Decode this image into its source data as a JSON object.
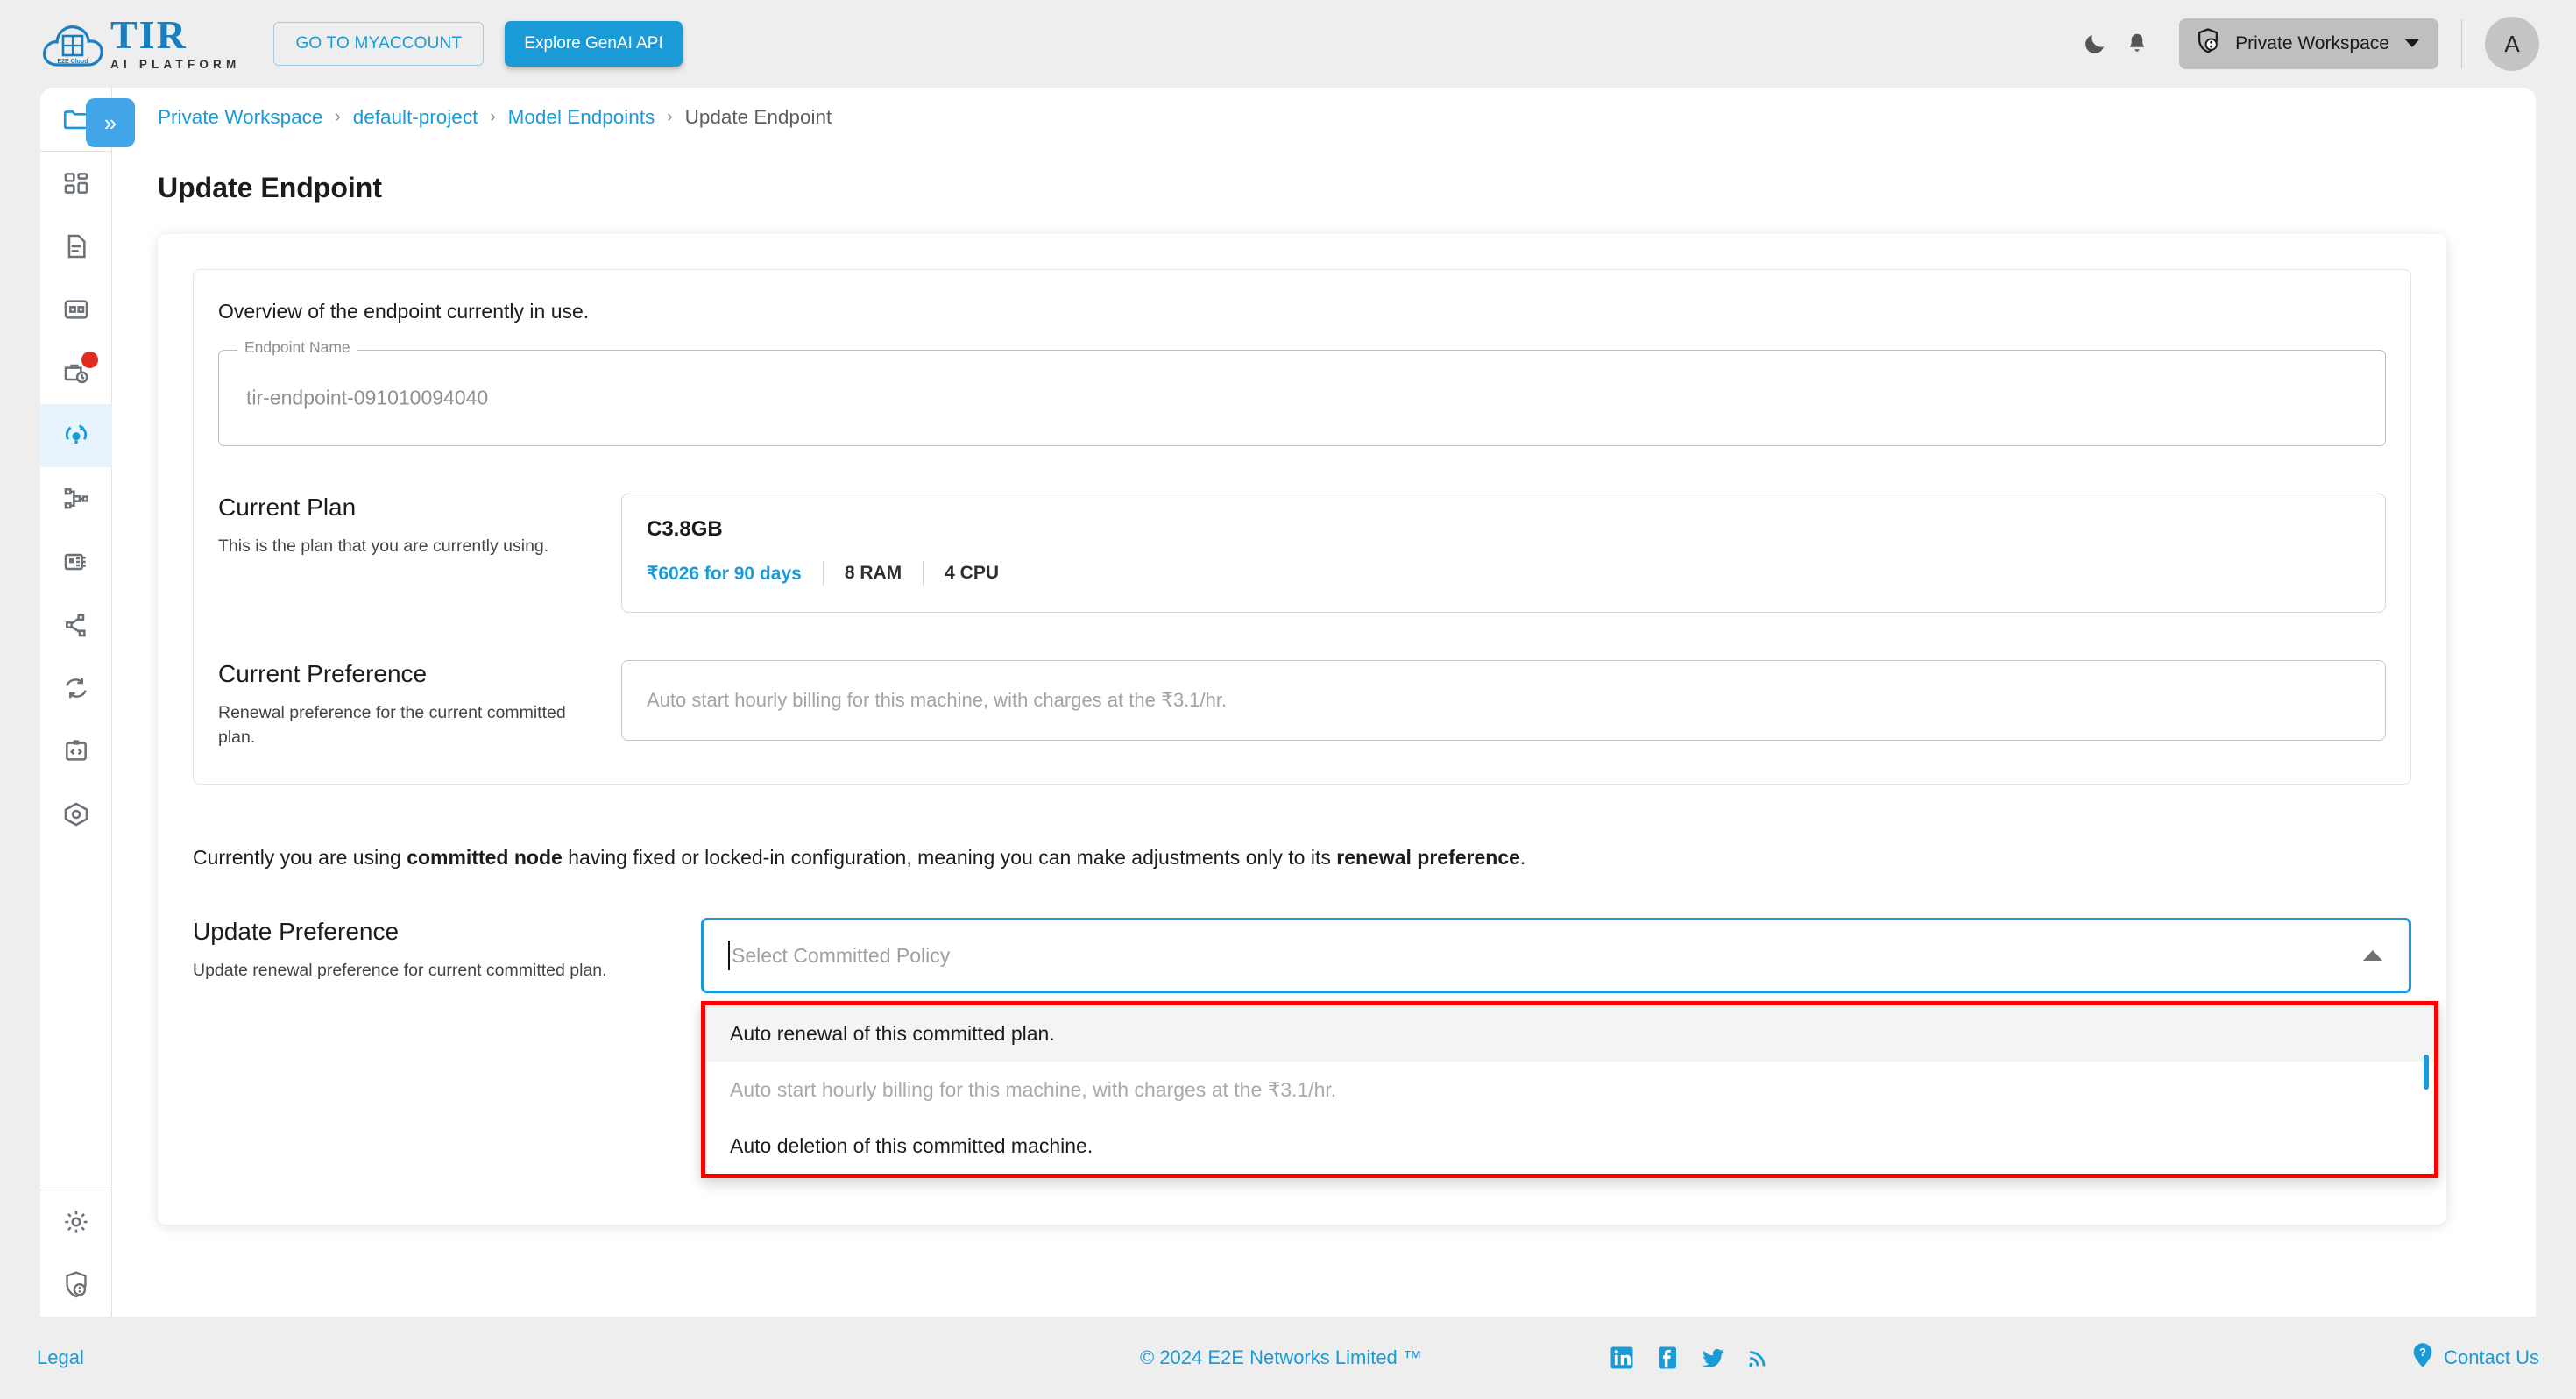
{
  "brand": {
    "logo_title": "TIR",
    "logo_subtitle": "AI PLATFORM",
    "logo_cloud_text": "E2E Cloud"
  },
  "topbar": {
    "myaccount_label": "GO TO MYACCOUNT",
    "genai_label": "Explore GenAI API",
    "dark_mode_icon": "moon-icon",
    "notification_icon": "bell-icon",
    "workspace_label": "Private Workspace",
    "workspace_icon": "shield-user-icon",
    "workspace_caret": "chevron-down-icon",
    "avatar_initial": "A"
  },
  "sidebar": {
    "collapse_icon": "double-chevron-right-icon",
    "items": [
      {
        "name": "folder-icon",
        "state": "blue"
      },
      {
        "name": "dashboard-grid-icon",
        "state": "default"
      },
      {
        "name": "document-icon",
        "state": "default"
      },
      {
        "name": "table-grid-icon",
        "state": "default"
      },
      {
        "name": "briefcase-clock-icon",
        "state": "badge"
      },
      {
        "name": "model-endpoint-icon",
        "state": "active"
      },
      {
        "name": "pipeline-node-icon",
        "state": "default"
      },
      {
        "name": "gpu-chip-icon",
        "state": "default"
      },
      {
        "name": "share-nodes-icon",
        "state": "default"
      },
      {
        "name": "sync-refresh-icon",
        "state": "default"
      },
      {
        "name": "code-clipboard-icon",
        "state": "default"
      },
      {
        "name": "container-box-icon",
        "state": "default"
      }
    ],
    "bottom_items": [
      {
        "name": "settings-gear-icon"
      },
      {
        "name": "shield-user-icon"
      }
    ]
  },
  "breadcrumb": {
    "items": [
      {
        "label": "Private Workspace",
        "type": "link"
      },
      {
        "label": "default-project",
        "type": "link"
      },
      {
        "label": "Model Endpoints",
        "type": "link"
      },
      {
        "label": "Update Endpoint",
        "type": "current"
      }
    ],
    "separator": "›"
  },
  "page": {
    "title": "Update Endpoint"
  },
  "overview": {
    "lead": "Overview of the endpoint currently in use.",
    "endpoint_field_label": "Endpoint Name",
    "endpoint_field_value": "tir-endpoint-091010094040"
  },
  "current_plan": {
    "heading": "Current Plan",
    "description": "This is the plan that you are currently using.",
    "plan_name": "C3.8GB",
    "price": "₹6026 for 90 days",
    "ram": "8 RAM",
    "cpu": "4 CPU"
  },
  "current_preference": {
    "heading": "Current Preference",
    "description": "Renewal preference for the current committed plan.",
    "value": "Auto start hourly billing for this machine, with charges at the ₹3.1/hr."
  },
  "notice": {
    "part1": "Currently you are using ",
    "bold1": "committed node",
    "part2": " having fixed or locked-in configuration, meaning you can make adjustments only to its ",
    "bold2": "renewal preference",
    "part3": "."
  },
  "update_preference": {
    "heading": "Update Preference",
    "description": "Update renewal preference for current committed plan.",
    "select_placeholder": "Select Committed Policy",
    "select_value": "",
    "caret_icon": "caret-up-icon",
    "options": [
      {
        "label": "Auto renewal of this committed plan.",
        "state": "hover"
      },
      {
        "label": "Auto start hourly billing for this machine, with charges at the ₹3.1/hr.",
        "state": "disabled"
      },
      {
        "label": "Auto deletion of this committed machine.",
        "state": "default"
      }
    ]
  },
  "footer": {
    "legal": "Legal",
    "copyright": "© 2024 E2E Networks Limited ™",
    "social": [
      {
        "name": "linkedin-icon"
      },
      {
        "name": "facebook-icon"
      },
      {
        "name": "twitter-icon"
      },
      {
        "name": "rss-icon"
      }
    ],
    "contact_label": "Contact Us",
    "contact_icon": "help-pin-icon"
  },
  "colors": {
    "accent_blue": "#1a9bd7",
    "annotation_red": "#ff0000",
    "page_bg": "#eeeeee",
    "active_nav_bg": "#e8f4fd",
    "badge_red": "#e02b20"
  }
}
